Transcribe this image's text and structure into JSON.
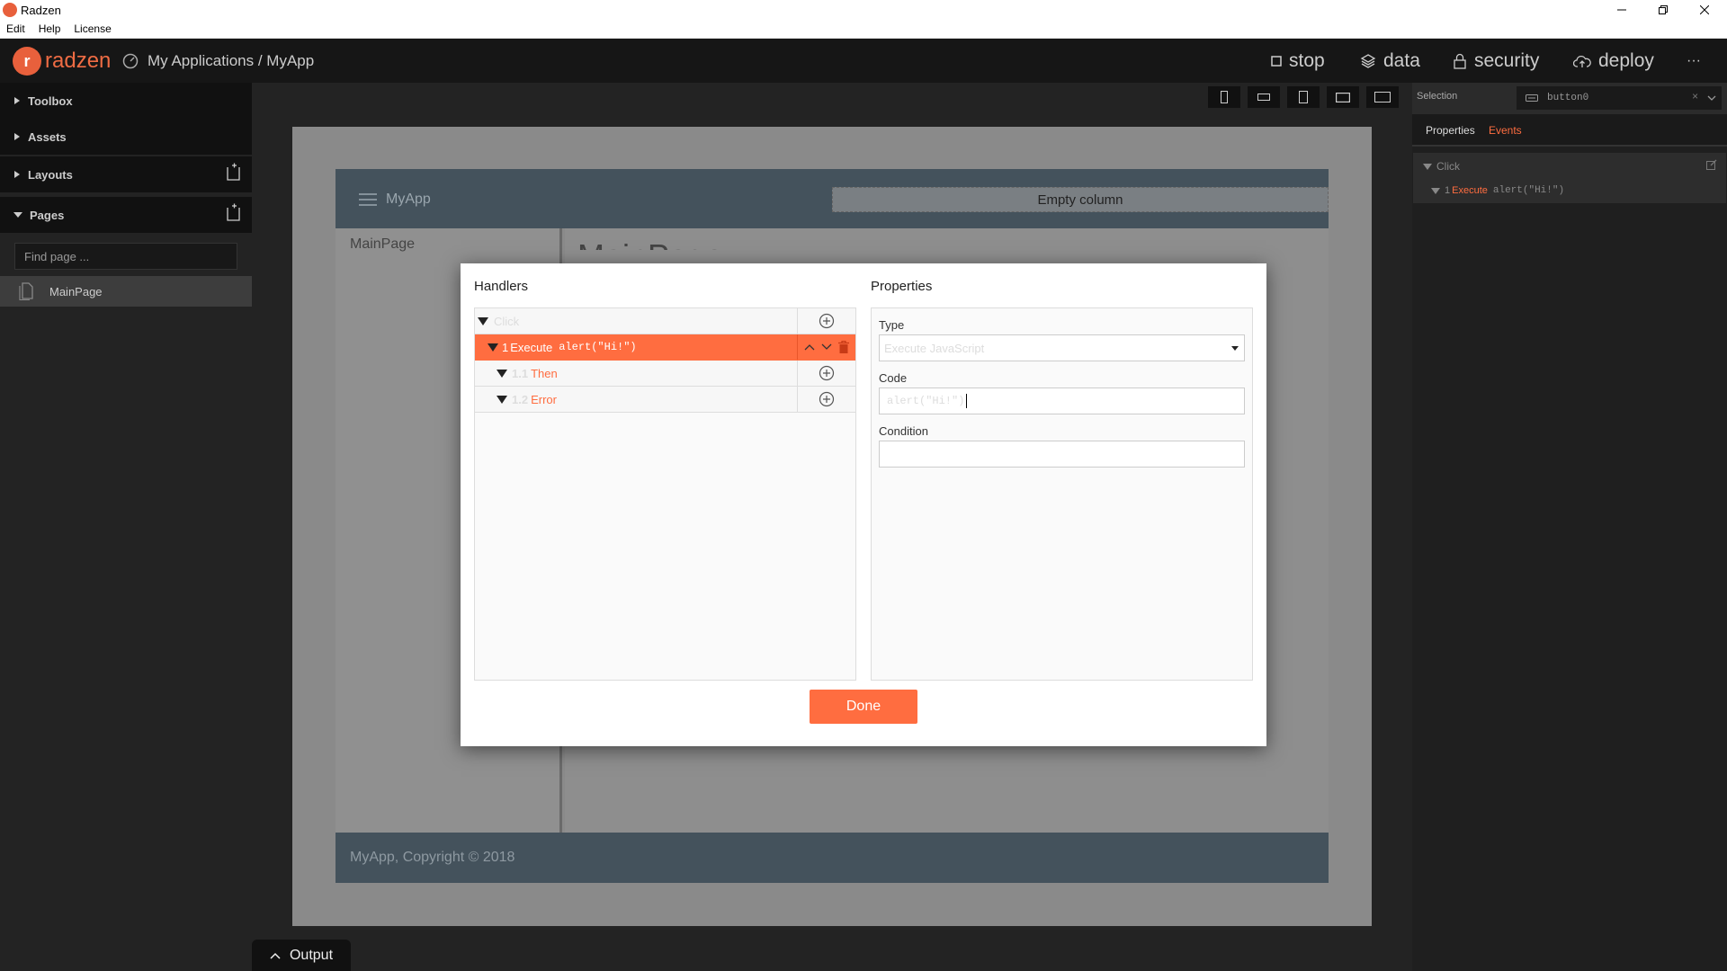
{
  "window": {
    "title": "Radzen"
  },
  "menu": {
    "items": [
      "Edit",
      "Help",
      "License"
    ]
  },
  "brand": {
    "name": "radzen"
  },
  "breadcrumb": "My Applications / MyApp",
  "topnav": {
    "stop": "stop",
    "data": "data",
    "security": "security",
    "deploy": "deploy",
    "more": "···"
  },
  "sidebar": {
    "toolbox": "Toolbox",
    "assets": "Assets",
    "layouts": "Layouts",
    "pages": "Pages",
    "find_placeholder": "Find page ...",
    "page_items": [
      "MainPage"
    ]
  },
  "canvas": {
    "app_title": "MyApp",
    "empty_column": "Empty column",
    "nav_item": "MainPage",
    "page_heading": "MainPage",
    "footer": "MyApp, Copyright © 2018"
  },
  "output": "Output",
  "right_panel": {
    "selection_label": "Selection",
    "selection_value": "button0",
    "clear": "×",
    "tabs": {
      "properties": "Properties",
      "events": "Events"
    },
    "tree": {
      "event": "Click",
      "action_num": "1",
      "action_type": "Execute",
      "action_code": "alert(\"Hi!\")"
    }
  },
  "dialog": {
    "handlers_title": "Handlers",
    "properties_title": "Properties",
    "event": "Click",
    "action": {
      "num": "1",
      "type": "Execute",
      "code": "alert(\"Hi!\")"
    },
    "then": {
      "num": "1.1",
      "label": "Then"
    },
    "error": {
      "num": "1.2",
      "label": "Error"
    },
    "type_label": "Type",
    "type_value": "Execute JavaScript",
    "code_label": "Code",
    "code_value": "alert(\"Hi!\")",
    "condition_label": "Condition",
    "condition_value": "",
    "done": "Done"
  },
  "colors": {
    "accent": "#ff6d40",
    "brand": "#e8603c",
    "app_header": "#44525c"
  }
}
